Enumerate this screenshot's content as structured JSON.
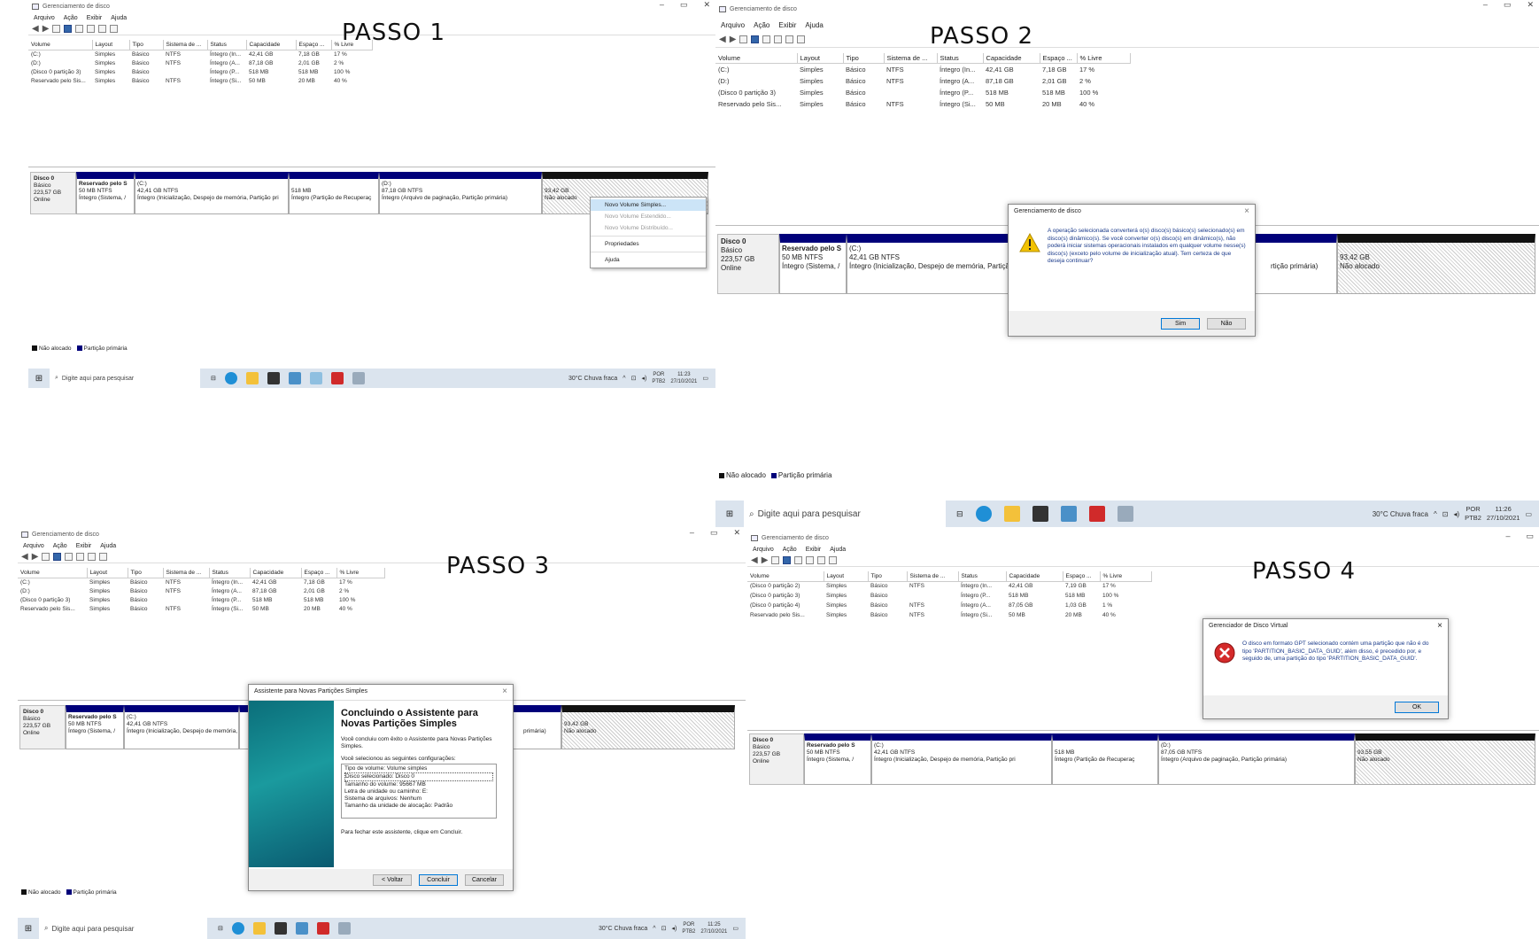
{
  "labels": {
    "step1": "PASSO 1",
    "step2": "PASSO 2",
    "step3": "PASSO 3",
    "step4": "PASSO 4"
  },
  "app": {
    "title": "Gerenciamento de disco",
    "menu": [
      "Arquivo",
      "Ação",
      "Exibir",
      "Ajuda"
    ]
  },
  "columns": [
    "Volume",
    "Layout",
    "Tipo",
    "Sistema de ...",
    "Status",
    "Capacidade",
    "Espaço ...",
    "% Livre"
  ],
  "volumes_a": [
    [
      "(C:)",
      "Simples",
      "Básico",
      "NTFS",
      "Íntegro (In...",
      "42,41 GB",
      "7,18 GB",
      "17 %"
    ],
    [
      "(D:)",
      "Simples",
      "Básico",
      "NTFS",
      "Íntegro (A...",
      "87,18 GB",
      "2,01 GB",
      "2 %"
    ],
    [
      "(Disco 0 partição 3)",
      "Simples",
      "Básico",
      "",
      "Íntegro (P...",
      "518 MB",
      "518 MB",
      "100 %"
    ],
    [
      "Reservado pelo Sis...",
      "Simples",
      "Básico",
      "NTFS",
      "Íntegro (Si...",
      "50 MB",
      "20 MB",
      "40 %"
    ]
  ],
  "volumes_b": [
    [
      "(Disco 0 partição 2)",
      "Simples",
      "Básico",
      "NTFS",
      "Íntegro (In...",
      "42,41 GB",
      "7,19 GB",
      "17 %"
    ],
    [
      "(Disco 0 partição 3)",
      "Simples",
      "Básico",
      "",
      "Íntegro (P...",
      "518 MB",
      "518 MB",
      "100 %"
    ],
    [
      "(Disco 0 partição 4)",
      "Simples",
      "Básico",
      "NTFS",
      "Íntegro (A...",
      "87,05 GB",
      "1,03 GB",
      "1 %"
    ],
    [
      "Reservado pelo Sis...",
      "Simples",
      "Básico",
      "NTFS",
      "Íntegro (Si...",
      "50 MB",
      "20 MB",
      "40 %"
    ]
  ],
  "disk": {
    "name": "Disco 0",
    "type": "Básico",
    "size": "223,57 GB",
    "state": "Online",
    "reserved": {
      "name": "Reservado pelo S",
      "info": "50 MB NTFS",
      "status": "Íntegro (Sistema, /"
    },
    "c": {
      "name": "(C:)",
      "info": "42,41 GB NTFS",
      "status": "Íntegro (Inicialização, Despejo de memória, Partição pri"
    },
    "rec": {
      "name": "",
      "info": "518 MB",
      "status": "Íntegro (Partição de Recuperaç"
    },
    "d": {
      "name": "(D:)",
      "info": "87,18 GB NTFS",
      "status": "Íntegro (Arquivo de paginação, Partição primária)"
    },
    "d4": {
      "name": "(D:)",
      "info": "87,05 GB NTFS",
      "status": "Íntegro (Arquivo de paginação, Partição primária)"
    },
    "un": {
      "info": "93,42 GB",
      "status": "Não alocado"
    },
    "un4": {
      "info": "93,55 GB",
      "status": "Não alocado"
    },
    "tail_p2": "rtição primária)",
    "tail_p3": "primária)"
  },
  "legend": {
    "unalloc": "Não alocado",
    "primary": "Partição primária"
  },
  "context_menu": [
    "Novo Volume Simples...",
    "Novo Volume Estendido...",
    "Novo Volume Distribuído...",
    "Propriedades",
    "Ajuda"
  ],
  "taskbar": {
    "search": "Digite aqui para pesquisar",
    "weather": "30°C  Chuva fraca",
    "lang1": "POR",
    "lang2": "PTB2",
    "time1": "11:23",
    "time2": "11:26",
    "time3": "11:25",
    "date": "27/10/2021"
  },
  "dialog2": {
    "title": "Gerenciamento de disco",
    "message": "A operação selecionada converterá o(s) disco(s) básico(s) selecionado(s) em disco(s) dinâmico(s). Se você converter o(s) disco(s) em dinâmico(s), não poderá iniciar sistemas operacionais instalados em qualquer volume nesse(s) disco(s) (exceto pelo volume de inicialização atual). Tem certeza de que deseja continuar?",
    "yes": "Sim",
    "no": "Não"
  },
  "wizard": {
    "title": "Assistente para Novas Partições Simples",
    "heading": "Concluindo o Assistente para Novas Partições Simples",
    "intro": "Você concluiu com êxito o Assistente para Novas Partições Simples.",
    "selected": "Você selecionou as seguintes configurações:",
    "settings": [
      "Tipo de volume: Volume simples",
      "Disco selecionado: Disco 0",
      "Tamanho do volume: 95667 MB",
      "Letra de unidade ou caminho: E:",
      "Sistema de arquivos: Nenhum",
      "Tamanho da unidade de alocação: Padrão"
    ],
    "close_text": "Para fechar este assistente, clique em Concluir.",
    "back": "< Voltar",
    "finish": "Concluir",
    "cancel": "Cancelar"
  },
  "dialog4": {
    "title": "Gerenciador de Disco Virtual",
    "message": "O disco em formato GPT selecionado contém uma partição que não é do tipo 'PARTITION_BASIC_DATA_GUID', além disso, é precedido por, e seguido de, uma partição do tipo 'PARTITION_BASIC_DATA_GUID'.",
    "ok": "OK"
  }
}
